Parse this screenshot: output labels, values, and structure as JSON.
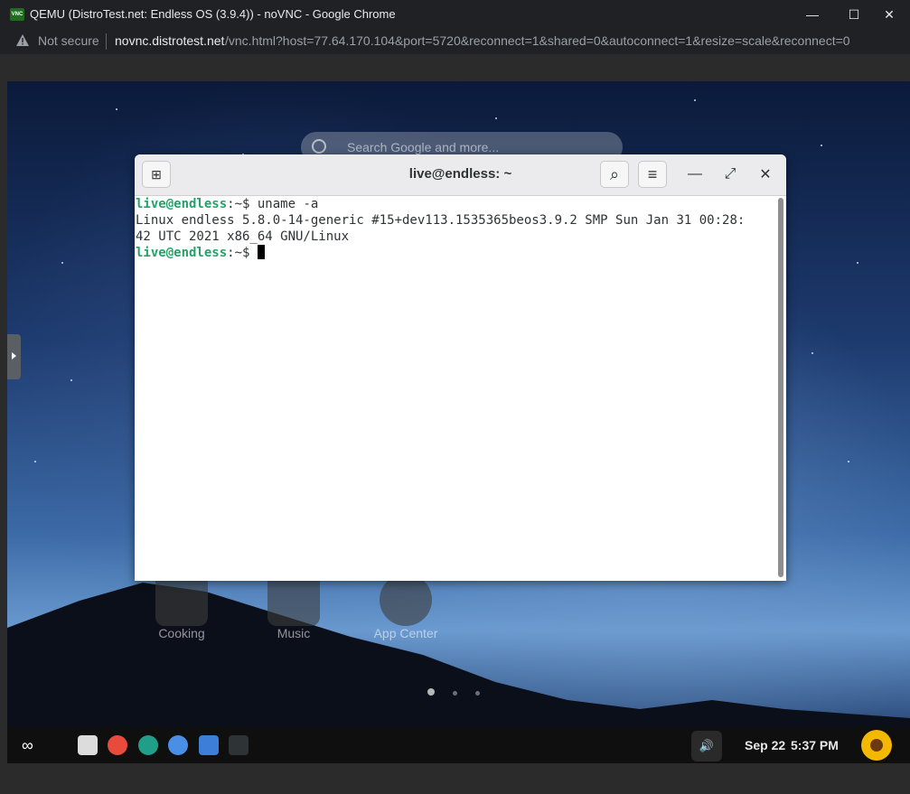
{
  "window": {
    "title": "QEMU (DistroTest.net: Endless OS (3.9.4)) - noVNC - Google Chrome",
    "vnc_badge": "VNC",
    "minimize_glyph": "—",
    "maximize_glyph": "☐",
    "close_glyph": "✕"
  },
  "addressbar": {
    "security_label": "Not secure",
    "host": "novnc.distrotest.net",
    "path": "/vnc.html?host=77.64.170.104&port=5720&reconnect=1&shared=0&autoconnect=1&resize=scale&reconnect=0"
  },
  "desktop": {
    "search_placeholder": "Search Google and more...",
    "apps": [
      {
        "label": "Cooking",
        "icon": "cooking-icon"
      },
      {
        "label": "Music",
        "icon": "music-icon"
      },
      {
        "label": "App Center",
        "icon": "app-center-icon"
      }
    ]
  },
  "terminal": {
    "title": "live@endless: ~",
    "new_tab_glyph": "⊞",
    "search_glyph": "⌕",
    "menu_glyph": "≡",
    "minimize_glyph": "—",
    "maximize_glyph": "⤢",
    "close_glyph": "✕",
    "prompt": "live@endless",
    "prompt_suffix": ":~$ ",
    "command": "uname -a",
    "output_line1": "Linux endless 5.8.0-14-generic #15+dev113.1535365beos3.9.2 SMP Sun Jan 31 00:28:",
    "output_line2": "42 UTC 2021 x86_64 GNU/Linux"
  },
  "taskbar": {
    "date": "Sep 22",
    "time": "5:37 PM",
    "volume_glyph": "🔊",
    "endless_glyph": "∞",
    "icons": [
      "files-icon",
      "add-app-icon",
      "maps-icon",
      "chromium-icon",
      "docs-icon",
      "terminal-icon"
    ],
    "colors": {
      "files": "#dcdcdc",
      "add": "#e84a3c",
      "maps": "#1f9e8a",
      "chromium": "#4a8fe7",
      "docs": "#3d7fd8",
      "terminal": "#2e3436"
    }
  }
}
